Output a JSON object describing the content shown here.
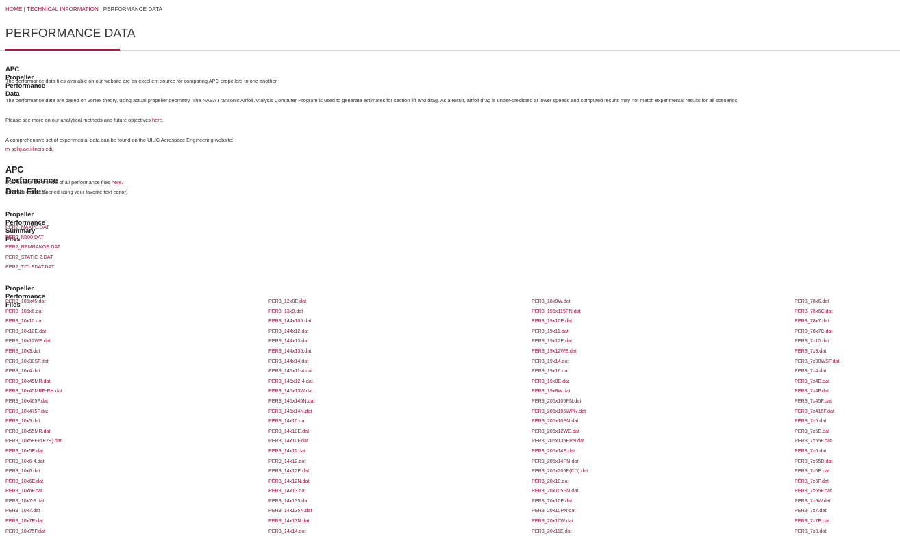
{
  "breadcrumb": {
    "home": "HOME",
    "sep": " | ",
    "technical": "TECHNICAL INFORMATION",
    "current": "PERFORMANCE DATA"
  },
  "page_title": "PERFORMANCE DATA",
  "apc_section": {
    "heading": "APC Propeller Performance Data",
    "p1": "The performance data files available on our website are an excellent source for comparing APC propellers to one another.",
    "p2": "The performance data are based on vortex theory, using actual propeller geometry. The NASA Transonic Airfoil Analysis Computer Program is used to generate estimates for section lift and drag. As a result, airfoil drag is under-predicted at lower speeds and computed results may not match experimental results for all scenarios.",
    "p3_before": "Please see more on our analytical methods and future objectives ",
    "p3_link": "here",
    "p3_after": ".",
    "p4": "A comprehensive set of experimental data can be found on the UIUC Aerospace Engineering website:",
    "p4_link": "m-selig.ae.illinois.edu"
  },
  "files_section": {
    "heading": "APC Performance Data Files",
    "download_before": "Download a zip archive of all performance files ",
    "download_link": "here",
    "download_after": ".",
    "note": "(the files can be opened using your favorite text editor)"
  },
  "summary_section": {
    "heading": "Propeller Performance Summary Files",
    "files": [
      "PER2_MAXPE.DAT",
      "PER2_N100.DAT",
      "PER2_RPMRANGE.DAT",
      "PER2_STATIC-2.DAT",
      "PER2_TITLEDAT.DAT"
    ]
  },
  "performance_section": {
    "heading": "Propeller Performance Files",
    "columns": [
      [
        "PER3_105x45.dat",
        "PER3_105x6.dat",
        "PER3_10x10.dat",
        "PER3_10x10E.dat",
        "PER3_10x12WE.dat",
        "PER3_10x3.dat",
        "PER3_10x38SF.dat",
        "PER3_10x4.dat",
        "PER3_10x45MR.dat",
        "PER3_10x45MRF-RH.dat",
        "PER3_10x465F.dat",
        "PER3_10x475F.dat",
        "PER3_10x5.dat",
        "PER3_10x55MR.dat",
        "PER3_10x58EP(F2B).dat",
        "PER3_10x5E.dat",
        "PER3_10x6-4.dat",
        "PER3_10x6.dat",
        "PER3_10x6E.dat",
        "PER3_10x6F.dat",
        "PER3_10x7-3.dat",
        "PER3_10x7.dat",
        "PER3_10x7E.dat",
        "PER3_10x75F.dat"
      ],
      [
        "PER3_12x8E.dat",
        "PER3_13x9.dat",
        "PER3_144x105.dat",
        "PER3_144x12.dat",
        "PER3_144x13.dat",
        "PER3_144x135.dat",
        "PER3_144x14.dat",
        "PER3_145x11-4.dat",
        "PER3_145x12-4.dat",
        "PER3_145x13W.dat",
        "PER3_145x145N.dat",
        "PER3_145x14N.dat",
        "PER3_14x10.dat",
        "PER3_14x10E.dat",
        "PER3_14x10F.dat",
        "PER3_14x11.dat",
        "PER3_14x12.dat",
        "PER3_14x12E.dat",
        "PER3_14x12N.dat",
        "PER3_14x13.dat",
        "PER3_14x135.dat",
        "PER3_14x135N.dat",
        "PER3_14x13N.dat",
        "PER3_14x14.dat"
      ],
      [
        "PER3_18x8W.dat",
        "PER3_195x115PN.dat",
        "PER3_19x10E.dat",
        "PER3_19x11.dat",
        "PER3_19x12E.dat",
        "PER3_19x12WE.dat",
        "PER3_19x14.dat",
        "PER3_19x16.dat",
        "PER3_19x8E.dat",
        "PER3_19x8W.dat",
        "PER3_205x105PN.dat",
        "PER3_205x105WPN.dat",
        "PER3_205x10PN.dat",
        "PER3_205x12WE.dat",
        "PER3_205x135EPN.dat",
        "PER3_205x14E.dat",
        "PER3_205x14PN.dat",
        "PER3_205x205E(CD).dat",
        "PER3_20x10.dat",
        "PER3_20x105PN.dat",
        "PER3_20x10E.dat",
        "PER3_20x10PN.dat",
        "PER3_20x10W.dat",
        "PER3_20x11E.dat"
      ],
      [
        "PER3_78x6.dat",
        "PER3_78x6C.dat",
        "PER3_78x7.dat",
        "PER3_78x7C.dat",
        "PER3_7x10.dat",
        "PER3_7x3.dat",
        "PER3_7x38WSF.dat",
        "PER3_7x4.dat",
        "PER3_7x4E.dat",
        "PER3_7x4F.dat",
        "PER3_7x45F.dat",
        "PER3_7x415F.dat",
        "PER3_7x5.dat",
        "PER3_7x5E.dat",
        "PER3_7x55F.dat",
        "PER3_7x6.dat",
        "PER3_7x65D.dat",
        "PER3_7x6E.dat",
        "PER3_7x6F.dat",
        "PER3_7x65F.dat",
        "PER3_7x6W.dat",
        "PER3_7x7.dat",
        "PER3_7x7E.dat",
        "PER3_7x8.dat"
      ]
    ]
  },
  "colors": {
    "link": "#a4123f",
    "accent": "#b5123f",
    "rule": "#d6d6d6"
  }
}
